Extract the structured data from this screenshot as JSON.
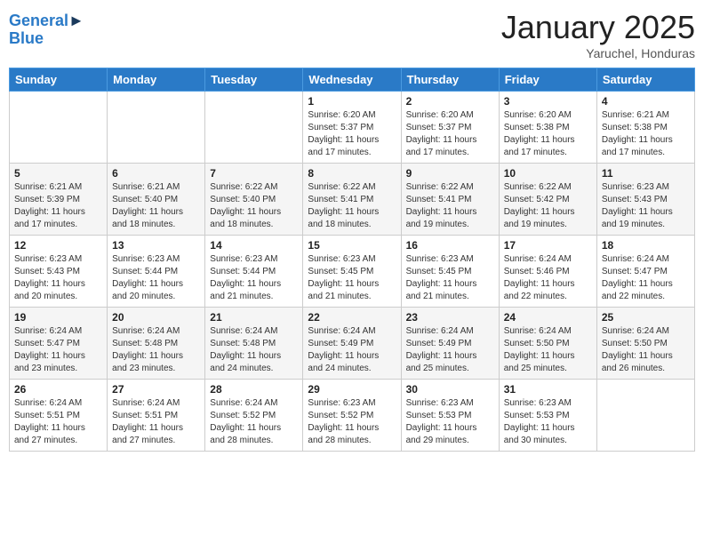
{
  "header": {
    "logo_line1": "General",
    "logo_line2": "Blue",
    "month_title": "January 2025",
    "location": "Yaruchel, Honduras"
  },
  "weekdays": [
    "Sunday",
    "Monday",
    "Tuesday",
    "Wednesday",
    "Thursday",
    "Friday",
    "Saturday"
  ],
  "weeks": [
    [
      {
        "day": "",
        "info": ""
      },
      {
        "day": "",
        "info": ""
      },
      {
        "day": "",
        "info": ""
      },
      {
        "day": "1",
        "info": "Sunrise: 6:20 AM\nSunset: 5:37 PM\nDaylight: 11 hours and 17 minutes."
      },
      {
        "day": "2",
        "info": "Sunrise: 6:20 AM\nSunset: 5:37 PM\nDaylight: 11 hours and 17 minutes."
      },
      {
        "day": "3",
        "info": "Sunrise: 6:20 AM\nSunset: 5:38 PM\nDaylight: 11 hours and 17 minutes."
      },
      {
        "day": "4",
        "info": "Sunrise: 6:21 AM\nSunset: 5:38 PM\nDaylight: 11 hours and 17 minutes."
      }
    ],
    [
      {
        "day": "5",
        "info": "Sunrise: 6:21 AM\nSunset: 5:39 PM\nDaylight: 11 hours and 17 minutes."
      },
      {
        "day": "6",
        "info": "Sunrise: 6:21 AM\nSunset: 5:40 PM\nDaylight: 11 hours and 18 minutes."
      },
      {
        "day": "7",
        "info": "Sunrise: 6:22 AM\nSunset: 5:40 PM\nDaylight: 11 hours and 18 minutes."
      },
      {
        "day": "8",
        "info": "Sunrise: 6:22 AM\nSunset: 5:41 PM\nDaylight: 11 hours and 18 minutes."
      },
      {
        "day": "9",
        "info": "Sunrise: 6:22 AM\nSunset: 5:41 PM\nDaylight: 11 hours and 19 minutes."
      },
      {
        "day": "10",
        "info": "Sunrise: 6:22 AM\nSunset: 5:42 PM\nDaylight: 11 hours and 19 minutes."
      },
      {
        "day": "11",
        "info": "Sunrise: 6:23 AM\nSunset: 5:43 PM\nDaylight: 11 hours and 19 minutes."
      }
    ],
    [
      {
        "day": "12",
        "info": "Sunrise: 6:23 AM\nSunset: 5:43 PM\nDaylight: 11 hours and 20 minutes."
      },
      {
        "day": "13",
        "info": "Sunrise: 6:23 AM\nSunset: 5:44 PM\nDaylight: 11 hours and 20 minutes."
      },
      {
        "day": "14",
        "info": "Sunrise: 6:23 AM\nSunset: 5:44 PM\nDaylight: 11 hours and 21 minutes."
      },
      {
        "day": "15",
        "info": "Sunrise: 6:23 AM\nSunset: 5:45 PM\nDaylight: 11 hours and 21 minutes."
      },
      {
        "day": "16",
        "info": "Sunrise: 6:23 AM\nSunset: 5:45 PM\nDaylight: 11 hours and 21 minutes."
      },
      {
        "day": "17",
        "info": "Sunrise: 6:24 AM\nSunset: 5:46 PM\nDaylight: 11 hours and 22 minutes."
      },
      {
        "day": "18",
        "info": "Sunrise: 6:24 AM\nSunset: 5:47 PM\nDaylight: 11 hours and 22 minutes."
      }
    ],
    [
      {
        "day": "19",
        "info": "Sunrise: 6:24 AM\nSunset: 5:47 PM\nDaylight: 11 hours and 23 minutes."
      },
      {
        "day": "20",
        "info": "Sunrise: 6:24 AM\nSunset: 5:48 PM\nDaylight: 11 hours and 23 minutes."
      },
      {
        "day": "21",
        "info": "Sunrise: 6:24 AM\nSunset: 5:48 PM\nDaylight: 11 hours and 24 minutes."
      },
      {
        "day": "22",
        "info": "Sunrise: 6:24 AM\nSunset: 5:49 PM\nDaylight: 11 hours and 24 minutes."
      },
      {
        "day": "23",
        "info": "Sunrise: 6:24 AM\nSunset: 5:49 PM\nDaylight: 11 hours and 25 minutes."
      },
      {
        "day": "24",
        "info": "Sunrise: 6:24 AM\nSunset: 5:50 PM\nDaylight: 11 hours and 25 minutes."
      },
      {
        "day": "25",
        "info": "Sunrise: 6:24 AM\nSunset: 5:50 PM\nDaylight: 11 hours and 26 minutes."
      }
    ],
    [
      {
        "day": "26",
        "info": "Sunrise: 6:24 AM\nSunset: 5:51 PM\nDaylight: 11 hours and 27 minutes."
      },
      {
        "day": "27",
        "info": "Sunrise: 6:24 AM\nSunset: 5:51 PM\nDaylight: 11 hours and 27 minutes."
      },
      {
        "day": "28",
        "info": "Sunrise: 6:24 AM\nSunset: 5:52 PM\nDaylight: 11 hours and 28 minutes."
      },
      {
        "day": "29",
        "info": "Sunrise: 6:23 AM\nSunset: 5:52 PM\nDaylight: 11 hours and 28 minutes."
      },
      {
        "day": "30",
        "info": "Sunrise: 6:23 AM\nSunset: 5:53 PM\nDaylight: 11 hours and 29 minutes."
      },
      {
        "day": "31",
        "info": "Sunrise: 6:23 AM\nSunset: 5:53 PM\nDaylight: 11 hours and 30 minutes."
      },
      {
        "day": "",
        "info": ""
      }
    ]
  ]
}
